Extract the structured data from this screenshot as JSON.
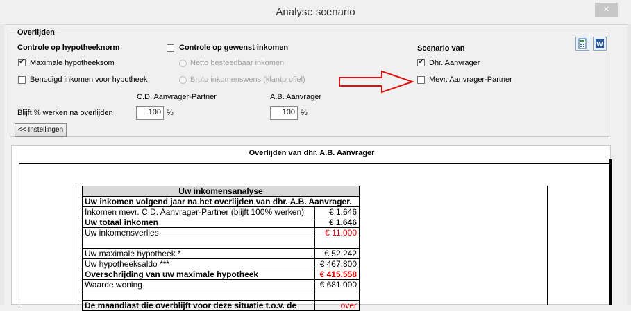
{
  "window": {
    "title": "Analyse scenario",
    "close_label": "×"
  },
  "group": {
    "legend": "Overlijden",
    "controle_hypotheeknorm": "Controle op hypotheeknorm",
    "maximale_hypotheeksom": "Maximale hypotheeksom",
    "benodigd_inkomen": "Benodigd inkomen voor hypotheek",
    "controle_gewenst_inkomen": "Controle op gewenst inkomen",
    "netto_besteedbaar": "Netto besteedbaar inkomen",
    "bruto_inkomenswens": "Bruto inkomenswens (klantprofiel)",
    "scenario_van": "Scenario van",
    "dhr_aanvrager": "Dhr. Aanvrager",
    "mevr_partner": "Mevr. Aanvrager-Partner",
    "col_partner": "C.D. Aanvrager-Partner",
    "col_aanvrager": "A.B. Aanvrager",
    "blijft_werken": "Blijft % werken na overlijden",
    "partner_pct": "100",
    "aanvrager_pct": "100",
    "pct_sign": "%",
    "instellingen_button": "<< Instellingen",
    "checked": {
      "maximale_hypotheeksom": true,
      "benodigd_inkomen": false,
      "controle_gewenst_inkomen": false,
      "dhr_aanvrager": true,
      "mevr_partner": false
    }
  },
  "report": {
    "title": "Overlijden van dhr. A.B. Aanvrager",
    "table_header": "Uw inkomensanalyse",
    "subheader": "Uw inkomen volgend jaar na het overlijden van dhr. A.B. Aanvrager.",
    "rows": {
      "r1_label": "Inkomen mevr. C.D. Aanvrager-Partner (blijft 100% werken)",
      "r1_value": "€ 1.646",
      "r2_label": "Uw totaal inkomen",
      "r2_value": "€ 1.646",
      "r3_label": "Uw inkomensverlies",
      "r3_value": "€ 11.000",
      "r4_label": "Uw maximale hypotheek *",
      "r4_value": "€ 52.242",
      "r5_label": "Uw hypotheeksaldo ***",
      "r5_value": "€ 467.800",
      "r6_label": "Overschrijding van uw maximale hypotheek",
      "r6_value": "€ 415.558",
      "r7_label": "Waarde woning",
      "r7_value": "€ 681.000",
      "r8_label": "De maandlast die overblijft voor deze situatie t.o.v. de",
      "r8_value": "over"
    }
  },
  "colors": {
    "arrow": "#e01010",
    "negative": "#e00000",
    "table_header_bg": "#d9d9d9"
  },
  "icons": {
    "calc": "calculator-icon",
    "word": "word-icon"
  }
}
